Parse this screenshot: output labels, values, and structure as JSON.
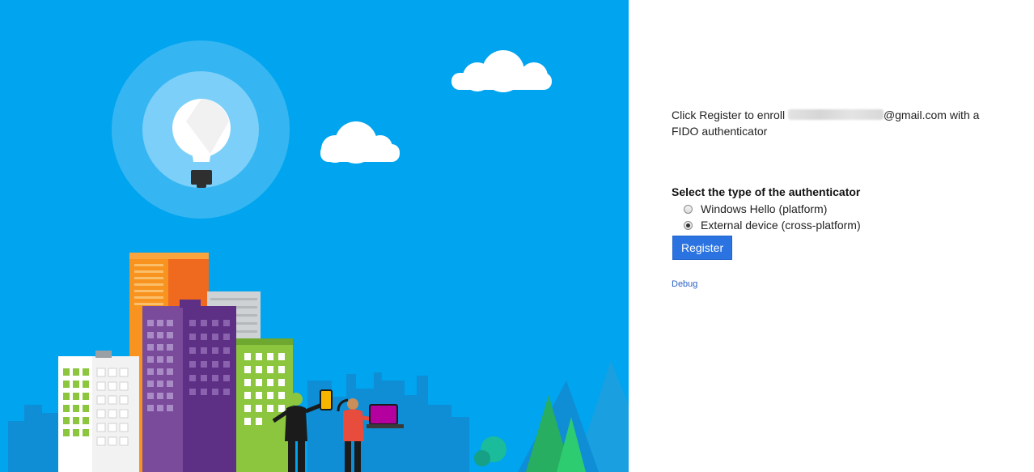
{
  "enroll": {
    "prefix": "Click Register to enroll ",
    "suffix": "@gmail.com with a FIDO authenticator"
  },
  "authenticator": {
    "heading": "Select the type of the authenticator",
    "options": [
      {
        "label": "Windows Hello (platform)",
        "selected": false
      },
      {
        "label": "External device (cross-platform)",
        "selected": true
      }
    ]
  },
  "register_label": "Register",
  "debug_label": "Debug",
  "colors": {
    "hero_background": "#00a4ef",
    "register_button": "#2b73e0",
    "link": "#2a62c4"
  }
}
